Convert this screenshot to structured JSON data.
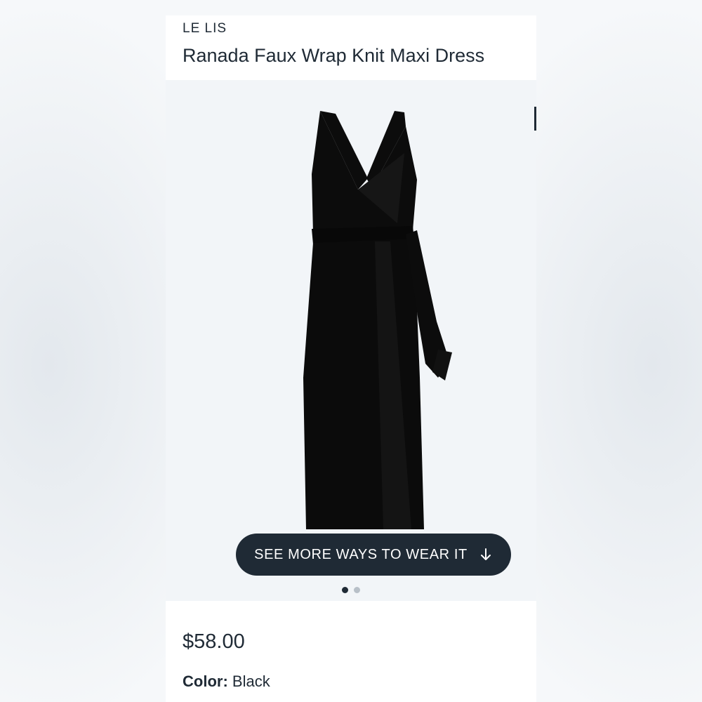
{
  "product": {
    "brand": "LE LIS",
    "title": "Ranada Faux Wrap Knit Maxi Dress",
    "price": "$58.00",
    "color_label": "Color:",
    "color_value": "Black"
  },
  "gallery": {
    "cta_label": "SEE MORE WAYS TO WEAR IT",
    "cta_icon": "arrow-down-icon",
    "image_subject": "black-dress-image",
    "dots_total": 2,
    "dots_active_index": 0
  },
  "colors": {
    "text": "#1f2a35",
    "gallery_bg": "#f2f5f8",
    "cta_bg": "#1f2a35",
    "dress": "#0c0c0c"
  }
}
